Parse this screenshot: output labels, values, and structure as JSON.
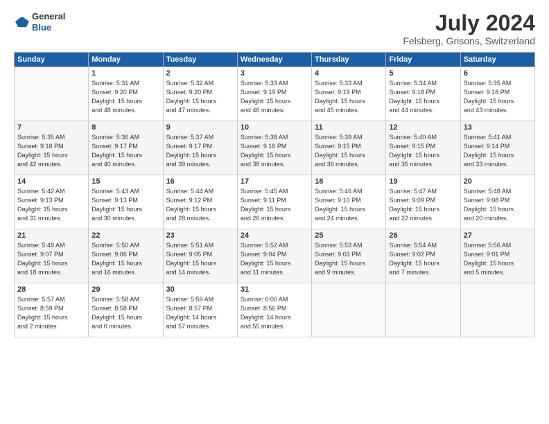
{
  "header": {
    "logo_general": "General",
    "logo_blue": "Blue",
    "month_year": "July 2024",
    "location": "Felsberg, Grisons, Switzerland"
  },
  "weekdays": [
    "Sunday",
    "Monday",
    "Tuesday",
    "Wednesday",
    "Thursday",
    "Friday",
    "Saturday"
  ],
  "weeks": [
    [
      {
        "day": "",
        "info": ""
      },
      {
        "day": "1",
        "info": "Sunrise: 5:31 AM\nSunset: 9:20 PM\nDaylight: 15 hours\nand 48 minutes."
      },
      {
        "day": "2",
        "info": "Sunrise: 5:32 AM\nSunset: 9:20 PM\nDaylight: 15 hours\nand 47 minutes."
      },
      {
        "day": "3",
        "info": "Sunrise: 5:33 AM\nSunset: 9:19 PM\nDaylight: 15 hours\nand 46 minutes."
      },
      {
        "day": "4",
        "info": "Sunrise: 5:33 AM\nSunset: 9:19 PM\nDaylight: 15 hours\nand 45 minutes."
      },
      {
        "day": "5",
        "info": "Sunrise: 5:34 AM\nSunset: 9:18 PM\nDaylight: 15 hours\nand 44 minutes."
      },
      {
        "day": "6",
        "info": "Sunrise: 5:35 AM\nSunset: 9:18 PM\nDaylight: 15 hours\nand 43 minutes."
      }
    ],
    [
      {
        "day": "7",
        "info": "Sunrise: 5:35 AM\nSunset: 9:18 PM\nDaylight: 15 hours\nand 42 minutes."
      },
      {
        "day": "8",
        "info": "Sunrise: 5:36 AM\nSunset: 9:17 PM\nDaylight: 15 hours\nand 40 minutes."
      },
      {
        "day": "9",
        "info": "Sunrise: 5:37 AM\nSunset: 9:17 PM\nDaylight: 15 hours\nand 39 minutes."
      },
      {
        "day": "10",
        "info": "Sunrise: 5:38 AM\nSunset: 9:16 PM\nDaylight: 15 hours\nand 38 minutes."
      },
      {
        "day": "11",
        "info": "Sunrise: 5:39 AM\nSunset: 9:15 PM\nDaylight: 15 hours\nand 36 minutes."
      },
      {
        "day": "12",
        "info": "Sunrise: 5:40 AM\nSunset: 9:15 PM\nDaylight: 15 hours\nand 35 minutes."
      },
      {
        "day": "13",
        "info": "Sunrise: 5:41 AM\nSunset: 9:14 PM\nDaylight: 15 hours\nand 33 minutes."
      }
    ],
    [
      {
        "day": "14",
        "info": "Sunrise: 5:42 AM\nSunset: 9:13 PM\nDaylight: 15 hours\nand 31 minutes."
      },
      {
        "day": "15",
        "info": "Sunrise: 5:43 AM\nSunset: 9:13 PM\nDaylight: 15 hours\nand 30 minutes."
      },
      {
        "day": "16",
        "info": "Sunrise: 5:44 AM\nSunset: 9:12 PM\nDaylight: 15 hours\nand 28 minutes."
      },
      {
        "day": "17",
        "info": "Sunrise: 5:45 AM\nSunset: 9:11 PM\nDaylight: 15 hours\nand 26 minutes."
      },
      {
        "day": "18",
        "info": "Sunrise: 5:46 AM\nSunset: 9:10 PM\nDaylight: 15 hours\nand 24 minutes."
      },
      {
        "day": "19",
        "info": "Sunrise: 5:47 AM\nSunset: 9:09 PM\nDaylight: 15 hours\nand 22 minutes."
      },
      {
        "day": "20",
        "info": "Sunrise: 5:48 AM\nSunset: 9:08 PM\nDaylight: 15 hours\nand 20 minutes."
      }
    ],
    [
      {
        "day": "21",
        "info": "Sunrise: 5:49 AM\nSunset: 9:07 PM\nDaylight: 15 hours\nand 18 minutes."
      },
      {
        "day": "22",
        "info": "Sunrise: 5:50 AM\nSunset: 9:06 PM\nDaylight: 15 hours\nand 16 minutes."
      },
      {
        "day": "23",
        "info": "Sunrise: 5:51 AM\nSunset: 9:05 PM\nDaylight: 15 hours\nand 14 minutes."
      },
      {
        "day": "24",
        "info": "Sunrise: 5:52 AM\nSunset: 9:04 PM\nDaylight: 15 hours\nand 11 minutes."
      },
      {
        "day": "25",
        "info": "Sunrise: 5:53 AM\nSunset: 9:03 PM\nDaylight: 15 hours\nand 9 minutes."
      },
      {
        "day": "26",
        "info": "Sunrise: 5:54 AM\nSunset: 9:02 PM\nDaylight: 15 hours\nand 7 minutes."
      },
      {
        "day": "27",
        "info": "Sunrise: 5:56 AM\nSunset: 9:01 PM\nDaylight: 15 hours\nand 5 minutes."
      }
    ],
    [
      {
        "day": "28",
        "info": "Sunrise: 5:57 AM\nSunset: 8:59 PM\nDaylight: 15 hours\nand 2 minutes."
      },
      {
        "day": "29",
        "info": "Sunrise: 5:58 AM\nSunset: 8:58 PM\nDaylight: 15 hours\nand 0 minutes."
      },
      {
        "day": "30",
        "info": "Sunrise: 5:59 AM\nSunset: 8:57 PM\nDaylight: 14 hours\nand 57 minutes."
      },
      {
        "day": "31",
        "info": "Sunrise: 6:00 AM\nSunset: 8:56 PM\nDaylight: 14 hours\nand 55 minutes."
      },
      {
        "day": "",
        "info": ""
      },
      {
        "day": "",
        "info": ""
      },
      {
        "day": "",
        "info": ""
      }
    ]
  ]
}
